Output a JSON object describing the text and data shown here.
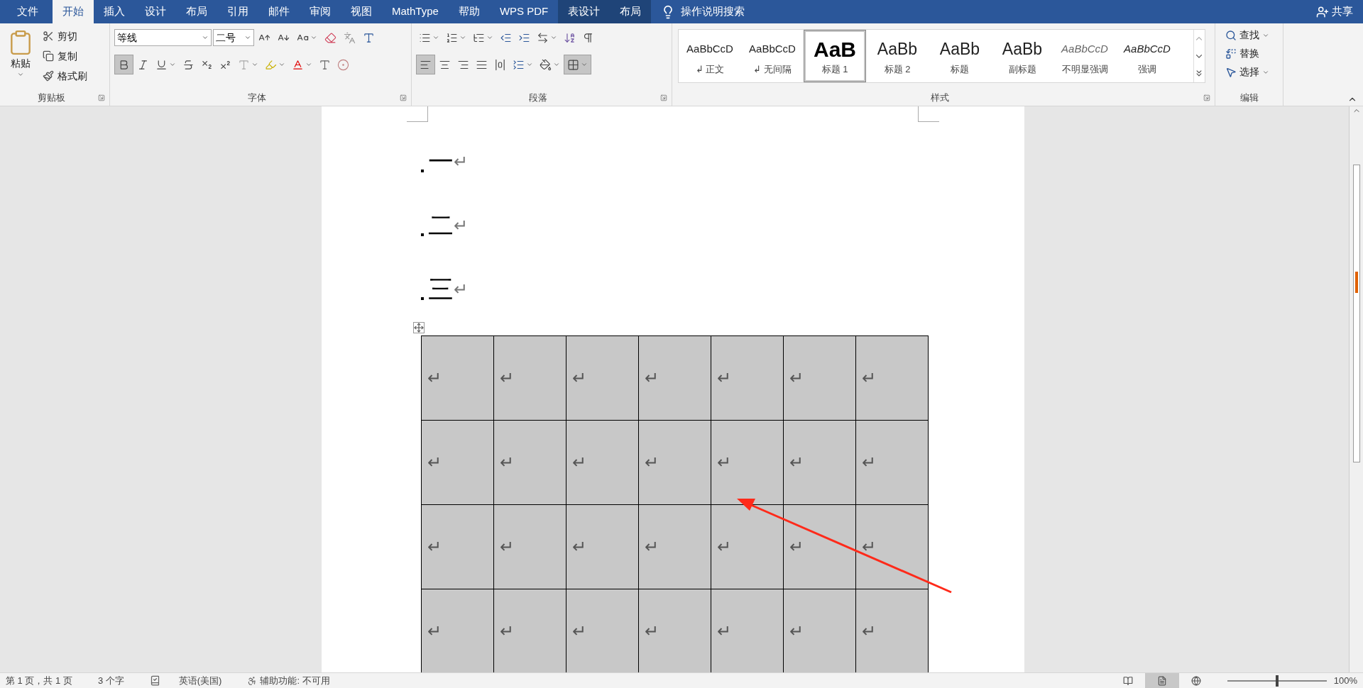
{
  "menu_tabs": [
    {
      "label": "文件",
      "selected": false,
      "kind": "file"
    },
    {
      "label": "开始",
      "selected": true,
      "kind": "main"
    },
    {
      "label": "插入",
      "selected": false,
      "kind": "main"
    },
    {
      "label": "设计",
      "selected": false,
      "kind": "main"
    },
    {
      "label": "布局",
      "selected": false,
      "kind": "main"
    },
    {
      "label": "引用",
      "selected": false,
      "kind": "main"
    },
    {
      "label": "邮件",
      "selected": false,
      "kind": "main"
    },
    {
      "label": "审阅",
      "selected": false,
      "kind": "main"
    },
    {
      "label": "视图",
      "selected": false,
      "kind": "main"
    },
    {
      "label": "MathType",
      "selected": false,
      "kind": "main"
    },
    {
      "label": "帮助",
      "selected": false,
      "kind": "main"
    },
    {
      "label": "WPS PDF",
      "selected": false,
      "kind": "main"
    },
    {
      "label": "表设计",
      "selected": false,
      "kind": "context"
    },
    {
      "label": "布局",
      "selected": false,
      "kind": "context"
    }
  ],
  "tell_me": "操作说明搜索",
  "share": "共享",
  "clipboard": {
    "paste": "粘贴",
    "actions": [
      {
        "label": "剪切",
        "kind": "cut"
      },
      {
        "label": "复制",
        "kind": "copy"
      },
      {
        "label": "格式刷",
        "kind": "painter"
      }
    ],
    "label": "剪贴板"
  },
  "font": {
    "name": "等线",
    "size": "二号",
    "bold": true,
    "label": "字体"
  },
  "paragraph": {
    "alignments": [
      {
        "kind": "left",
        "selected": true
      },
      {
        "kind": "center",
        "selected": false
      },
      {
        "kind": "right",
        "selected": false
      },
      {
        "kind": "justify",
        "selected": false
      },
      {
        "kind": "distributed",
        "selected": false
      }
    ],
    "borders_selected": true,
    "label": "段落"
  },
  "styles": {
    "items": [
      {
        "preview": "AaBbCcD",
        "name": "↲ 正文",
        "kind": "normal",
        "selected": false
      },
      {
        "preview": "AaBbCcD",
        "name": "↲ 无间隔",
        "kind": "normal",
        "selected": false
      },
      {
        "preview": "AaB",
        "name": "标题 1",
        "kind": "heading1",
        "selected": true
      },
      {
        "preview": "AaBb",
        "name": "标题 2",
        "kind": "heading2",
        "selected": false
      },
      {
        "preview": "AaBb",
        "name": "标题",
        "kind": "title",
        "selected": false
      },
      {
        "preview": "AaBb",
        "name": "副标题",
        "kind": "title",
        "selected": false
      },
      {
        "preview": "AaBbCcD",
        "name": "不明显强调",
        "kind": "subtle",
        "selected": false
      },
      {
        "preview": "AaBbCcD",
        "name": "强调",
        "kind": "emphasis",
        "selected": false
      }
    ],
    "label": "样式"
  },
  "editing": {
    "actions": [
      {
        "label": "查找",
        "kind": "find"
      },
      {
        "label": "替换",
        "kind": "replace"
      },
      {
        "label": "选择",
        "kind": "select"
      }
    ],
    "label": "编辑"
  },
  "document": {
    "lines": [
      {
        "text": "一",
        "mark": "↵"
      },
      {
        "text": "二",
        "mark": "↵"
      },
      {
        "text": "三",
        "mark": "↵"
      }
    ],
    "table": {
      "selected": true,
      "rows": [
        [
          "↵",
          "↵",
          "↵",
          "↵",
          "↵",
          "↵",
          "↵"
        ],
        [
          "↵",
          "↵",
          "↵",
          "↵",
          "↵",
          "↵",
          "↵"
        ],
        [
          "↵",
          "↵",
          "↵",
          "↵",
          "↵",
          "↵",
          "↵"
        ],
        [
          "↵",
          "↵",
          "↵",
          "↵",
          "↵",
          "↵",
          "↵"
        ]
      ]
    }
  },
  "status_bar": {
    "items": [
      {
        "text": "第 1 页，共 1 页",
        "kind": "text"
      },
      {
        "text": "3 个字",
        "kind": "text"
      },
      {
        "kind": "proofing"
      },
      {
        "text": "英语(美国)",
        "kind": "text"
      },
      {
        "text": "辅助功能: 不可用",
        "kind": "accessibility"
      }
    ],
    "views": [
      {
        "kind": "read",
        "selected": false
      },
      {
        "kind": "print",
        "selected": true
      },
      {
        "kind": "web",
        "selected": false
      }
    ],
    "zoom": "100%",
    "zoom_slider": {
      "level": 0.5
    }
  }
}
